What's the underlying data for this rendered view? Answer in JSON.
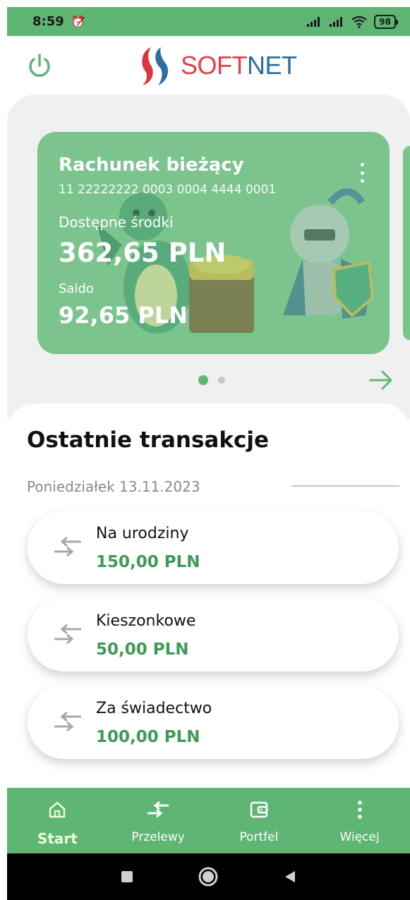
{
  "status_bar": {
    "time": "8:59",
    "battery": "98"
  },
  "brand": {
    "soft": "SOFT",
    "net": "NET"
  },
  "account": {
    "title": "Rachunek bieżący",
    "number": "11 22222222 0003 0004 4444 0001",
    "available_label": "Dostępne środki",
    "available": "362,65 PLN",
    "balance_label": "Saldo",
    "balance": "92,65 PLN"
  },
  "pager": {
    "count": 2,
    "active": 0
  },
  "transactions_section": {
    "title": "Ostatnie transakcje",
    "date": "Poniedziałek 13.11.2023",
    "items": [
      {
        "title": "Na urodziny",
        "amount": "150,00 PLN"
      },
      {
        "title": "Kieszonkowe",
        "amount": "50,00 PLN"
      },
      {
        "title": "Za świadectwo",
        "amount": "100,00 PLN"
      }
    ]
  },
  "nav": [
    {
      "label": "Start",
      "icon": "home-icon",
      "active": true
    },
    {
      "label": "Przelewy",
      "icon": "transfer-icon",
      "active": false
    },
    {
      "label": "Portfel",
      "icon": "wallet-icon",
      "active": false
    },
    {
      "label": "Więcej",
      "icon": "more-vertical-icon",
      "active": false
    }
  ],
  "colors": {
    "primary": "#5fb573",
    "card": "#7cc48d",
    "amount": "#3f9a57"
  }
}
